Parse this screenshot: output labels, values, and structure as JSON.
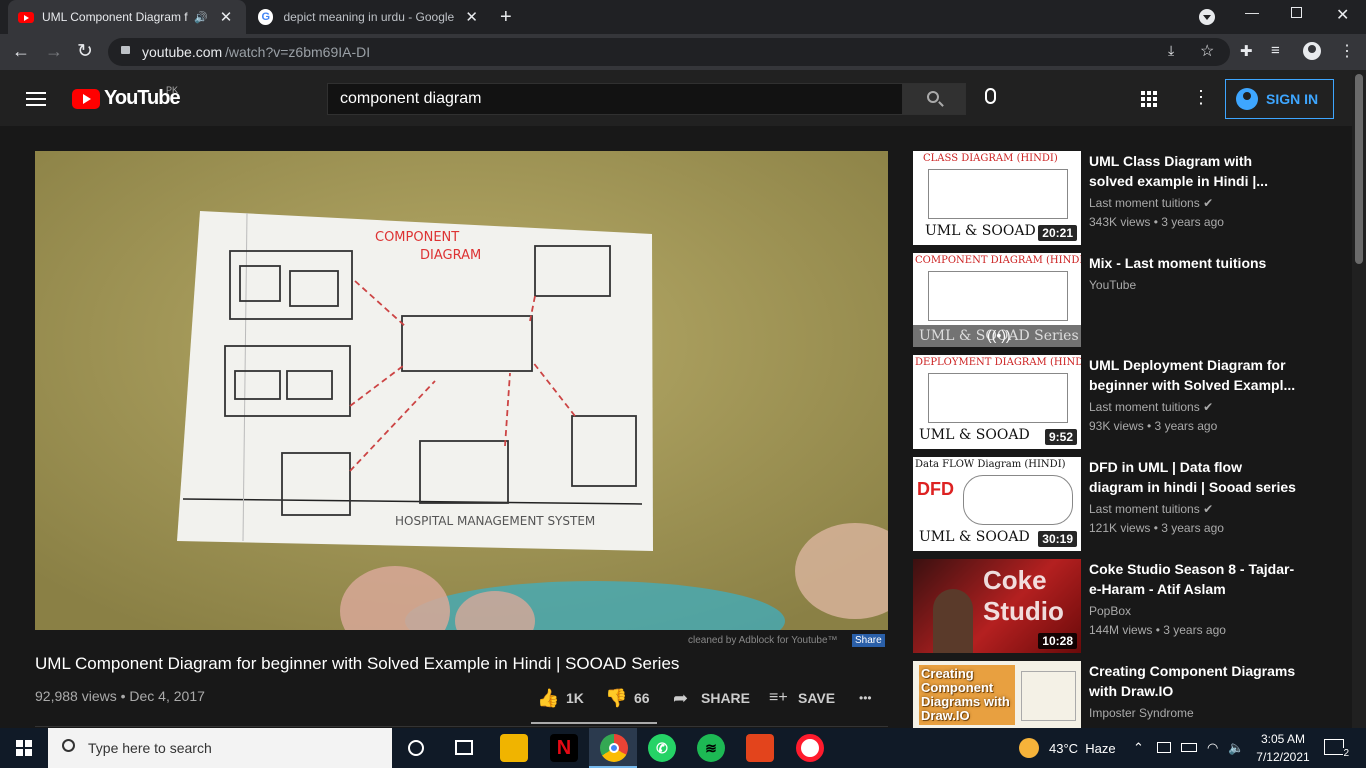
{
  "browser": {
    "tabs": [
      {
        "title": "UML Component Diagram fo",
        "active": true
      },
      {
        "title": "depict meaning in urdu - Google",
        "active": false
      }
    ],
    "url_domain": "youtube.com",
    "url_path": "/watch?v=z6bm69IA-DI"
  },
  "youtube": {
    "logo_text": "YouTube",
    "region": "PK",
    "search_value": "component diagram",
    "sign_in_label": "SIGN IN",
    "adblock_note": "cleaned by Adblock for Youtube™",
    "share_badge": "Share",
    "video": {
      "title": "UML Component Diagram for beginner with Solved Example in Hindi | SOOAD Series",
      "views_date": "92,988 views • Dec 4, 2017",
      "likes": "1K",
      "dislikes": "66",
      "share_label": "SHARE",
      "save_label": "SAVE",
      "more_label": "•••"
    },
    "video_frame": {
      "heading1": "COMPONENT",
      "heading2": "DIAGRAM",
      "footer": "HOSPITAL MANAGEMENT SYSTEM"
    },
    "recommendations": [
      {
        "title": "UML Class Diagram with solved example in Hindi |...",
        "channel": "Last moment tuitions",
        "meta": "343K views • 3 years ago",
        "duration": "20:21",
        "thumb_heading": "CLASS DIAGRAM (HINDI)",
        "thumb_footer": "UML & SOOAD",
        "verified": true
      },
      {
        "title": "Mix - Last moment tuitions",
        "channel": "YouTube",
        "meta": "",
        "duration": "",
        "thumb_heading": "COMPONENT DIAGRAM (HINDI)",
        "thumb_footer": "UML & SOOAD Series",
        "verified": false
      },
      {
        "title": "UML Deployment Diagram for beginner with Solved Exampl...",
        "channel": "Last moment tuitions",
        "meta": "93K views • 3 years ago",
        "duration": "9:52",
        "thumb_heading": "DEPLOYMENT DIAGRAM (HINDI)",
        "thumb_footer": "UML & SOOAD",
        "verified": true
      },
      {
        "title": "DFD in UML | Data flow diagram in hindi | Sooad series",
        "channel": "Last moment tuitions",
        "meta": "121K views • 3 years ago",
        "duration": "30:19",
        "thumb_heading": "Data FLOW Diagram (HINDI)",
        "thumb_footer": "UML & SOOAD",
        "verified": true
      },
      {
        "title": "Coke Studio Season 8 - Tajdar-e-Haram - Atif Aslam",
        "channel": "PopBox",
        "meta": "144M views • 3 years ago",
        "duration": "10:28",
        "thumb_heading": "Coke Studio",
        "thumb_footer": "",
        "verified": false
      },
      {
        "title": "Creating Component Diagrams with Draw.IO",
        "channel": "Imposter Syndrome",
        "meta": "",
        "duration": "",
        "thumb_heading": "Creating Component Diagrams with Draw.IO",
        "thumb_footer": "",
        "verified": false
      }
    ]
  },
  "taskbar": {
    "search_placeholder": "Type here to search",
    "weather": "43°C  Haze",
    "time": "3:05 AM",
    "date": "7/12/2021",
    "notifications": "2"
  }
}
